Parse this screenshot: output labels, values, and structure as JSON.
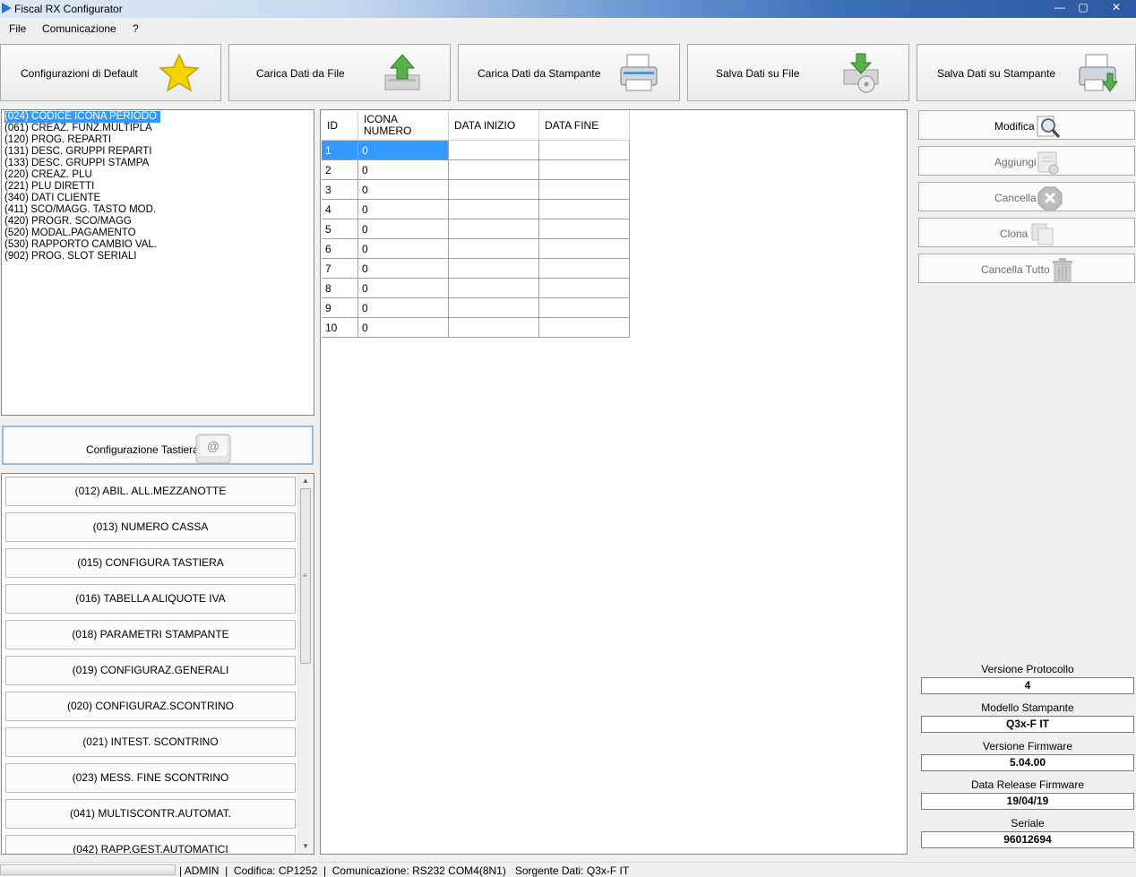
{
  "window": {
    "title": "Fiscal RX Configurator",
    "controls": {
      "minimize": "—",
      "maximize": "▢",
      "close": "✕"
    }
  },
  "menu": [
    "File",
    "Comunicazione",
    "?"
  ],
  "toolbar": [
    {
      "label": "Configurazioni di Default",
      "icon": "star-icon"
    },
    {
      "label": "Carica Dati da File",
      "icon": "upload-icon"
    },
    {
      "label": "Carica Dati da Stampante",
      "icon": "printer-icon"
    },
    {
      "label": "Salva Dati su File",
      "icon": "save-disk-icon"
    },
    {
      "label": "Salva Dati su Stampante",
      "icon": "printer-download-icon"
    }
  ],
  "program_list": [
    "(024) CODICE ICONA PERIODO",
    "(061) CREAZ. FUNZ.MULTIPLA",
    "(120) PROG. REPARTI",
    "(131) DESC. GRUPPI REPARTI",
    "(133) DESC. GRUPPI STAMPA",
    "(220) CREAZ. PLU",
    "(221) PLU DIRETTI",
    "(340) DATI CLIENTE",
    "(411) SCO/MAGG. TASTO MOD.",
    "(420) PROGR. SCO/MAGG",
    "(520) MODAL.PAGAMENTO",
    "(530) RAPPORTO CAMBIO VAL.",
    "(902) PROG. SLOT SERIALI"
  ],
  "keyboard_config": {
    "label": "Configurazione Tastiera",
    "icon_char": "@"
  },
  "commands": [
    "(012) ABIL. ALL.MEZZANOTTE",
    "(013) NUMERO CASSA",
    "(015) CONFIGURA TASTIERA",
    "(016) TABELLA ALIQUOTE IVA",
    "(018) PARAMETRI STAMPANTE",
    "(019) CONFIGURAZ.GENERALI",
    "(020) CONFIGURAZ.SCONTRINO",
    "(021) INTEST. SCONTRINO",
    "(023) MESS. FINE SCONTRINO",
    "(041) MULTISCONTR.AUTOMAT.",
    "(042) RAPP.GEST.AUTOMATICI"
  ],
  "grid": {
    "columns": {
      "id": "ID",
      "icona_1": "ICONA",
      "icona_2": "NUMERO",
      "data_inizio": "DATA INIZIO",
      "data_fine": "DATA FINE"
    },
    "rows": [
      [
        "1",
        "0",
        "",
        ""
      ],
      [
        "2",
        "0",
        "",
        ""
      ],
      [
        "3",
        "0",
        "",
        ""
      ],
      [
        "4",
        "0",
        "",
        ""
      ],
      [
        "5",
        "0",
        "",
        ""
      ],
      [
        "6",
        "0",
        "",
        ""
      ],
      [
        "7",
        "0",
        "",
        ""
      ],
      [
        "8",
        "0",
        "",
        ""
      ],
      [
        "9",
        "0",
        "",
        ""
      ],
      [
        "10",
        "0",
        "",
        ""
      ]
    ]
  },
  "actions": [
    {
      "label": "Modifica",
      "icon": "magnifier-icon",
      "enabled": true
    },
    {
      "label": "Aggiungi",
      "icon": "add-doc-icon",
      "enabled": false
    },
    {
      "label": "Cancella",
      "icon": "delete-icon",
      "enabled": false
    },
    {
      "label": "Clona",
      "icon": "clone-icon",
      "enabled": false
    },
    {
      "label": "Cancella Tutto",
      "icon": "trash-icon",
      "enabled": false
    }
  ],
  "info": [
    {
      "label": "Versione Protocollo",
      "value": "4"
    },
    {
      "label": "Modello Stampante",
      "value": "Q3x-F IT"
    },
    {
      "label": "Versione Firmware",
      "value": "5.04.00"
    },
    {
      "label": "Data Release Firmware",
      "value": "19/04/19"
    },
    {
      "label": "Seriale",
      "value": "96012694"
    }
  ],
  "status": "| ADMIN  |  Codifica: CP1252  |  Comunicazione: RS232 COM4(8N1)   Sorgente Dati: Q3x-F IT",
  "colors": {
    "selection": "#3399ff",
    "panel": "#f0f0f0",
    "accent_star": "#f5d300"
  }
}
